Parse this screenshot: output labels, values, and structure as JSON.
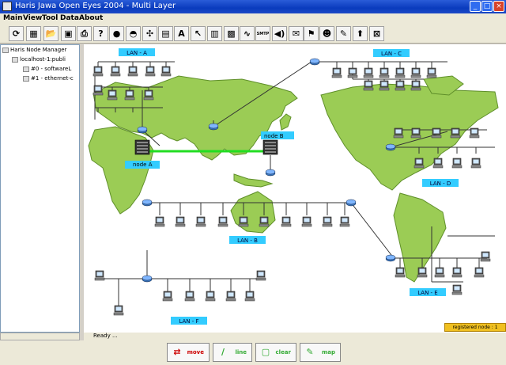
{
  "window": {
    "title": "Haris Jawa Open Eyes 2004 - Multi Layer",
    "min": "_",
    "max": "□",
    "close": "×"
  },
  "menu": [
    "Main",
    "View",
    "Tool",
    "Data",
    "About"
  ],
  "toolbar": [
    {
      "icon": "refresh-icon",
      "glyph": "⟳"
    },
    {
      "icon": "grid-icon",
      "glyph": "▦"
    },
    {
      "icon": "open-folder-icon",
      "glyph": "📂"
    },
    {
      "icon": "save-icon",
      "glyph": "▣"
    },
    {
      "icon": "print-icon",
      "glyph": "⎙"
    },
    {
      "icon": "help-icon",
      "glyph": "?"
    },
    {
      "icon": "node-circle-icon",
      "glyph": "●"
    },
    {
      "icon": "router-icon",
      "glyph": "◓"
    },
    {
      "icon": "network-icon",
      "glyph": "✣"
    },
    {
      "icon": "switch-icon",
      "glyph": "▤"
    },
    {
      "icon": "text-icon",
      "glyph": "A"
    },
    {
      "icon": "pointer-icon",
      "glyph": "↖"
    },
    {
      "icon": "calendar-icon",
      "glyph": "▥"
    },
    {
      "icon": "host-icon",
      "glyph": "▩"
    },
    {
      "icon": "link-icon",
      "glyph": "∿"
    },
    {
      "icon": "smtp-icon",
      "glyph": "SMTP"
    },
    {
      "icon": "sound-icon",
      "glyph": "◀)"
    },
    {
      "icon": "chat-icon",
      "glyph": "✉"
    },
    {
      "icon": "flag-icon",
      "glyph": "⚑"
    },
    {
      "icon": "user-icon",
      "glyph": "☻"
    },
    {
      "icon": "tools-icon",
      "glyph": "✎"
    },
    {
      "icon": "upload-icon",
      "glyph": "⬆"
    },
    {
      "icon": "close-box-icon",
      "glyph": "⊠"
    }
  ],
  "tree": {
    "root": "Haris Node Manager",
    "host": "localhost-1:publi",
    "interfaces": [
      "#0 - softwareL",
      "#1 - ethernet-c"
    ]
  },
  "lans": [
    "LAN - A",
    "LAN - B",
    "LAN - C",
    "LAN - D",
    "LAN - E",
    "LAN - F"
  ],
  "nodes": [
    "node A",
    "node B"
  ],
  "status": {
    "text": "Ready ...",
    "registered": "registered node : 1"
  },
  "buttons": [
    "move",
    "line",
    "clear",
    "map"
  ],
  "colors": {
    "ocean": "#ffffff",
    "land": "#9bcc55",
    "land_stroke": "#5f8f2a",
    "link": "#22dd22",
    "lan_label": "#33ccff",
    "title": "#0a3bbd"
  }
}
